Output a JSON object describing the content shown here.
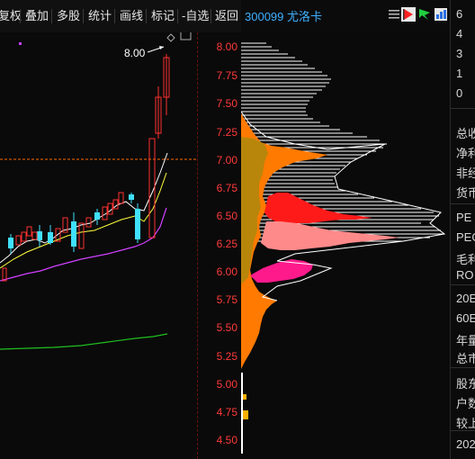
{
  "toolbar": {
    "items": [
      "复权",
      "叠加",
      "多股",
      "统计",
      "画线",
      "标记",
      "-自选",
      "返回"
    ]
  },
  "stock": {
    "title": "300099 尤洛卡"
  },
  "chart": {
    "annotation": "8.00",
    "price_labels": [
      "8.00",
      "7.75",
      "7.50",
      "7.25",
      "7.00",
      "6.75",
      "6.50",
      "6.25",
      "6.00",
      "5.75",
      "5.50",
      "5.25",
      "5.00",
      "4.75",
      "4.50"
    ]
  },
  "right_panel": {
    "numbers": [
      "6",
      "4",
      "3",
      "1",
      "0"
    ],
    "texts": [
      "总收",
      "净利",
      "非经",
      "货币",
      "PE",
      "PEG",
      "毛利",
      "RO",
      "20E",
      "60E",
      "年量",
      "总市",
      "股东",
      "户数",
      "较上",
      "202"
    ]
  },
  "colors": {
    "up": "#ff3030",
    "down": "#40e0ff",
    "chip_orange": "#ff7a00",
    "chip_red": "#ff1a1a",
    "chip_pink": "#ff8a8a",
    "chip_magenta": "#ff1a8c",
    "ma5": "#ffffff",
    "ma10": "#ffff40",
    "ma20": "#d040ff",
    "ma250": "#20c020",
    "price_axis": "#ff3a3a",
    "stock_title": "#3fb0ff"
  },
  "icons": [
    "menu-lines-icon",
    "flag-play-icon",
    "arrow-flag-icon",
    "grid-chart-icon"
  ]
}
